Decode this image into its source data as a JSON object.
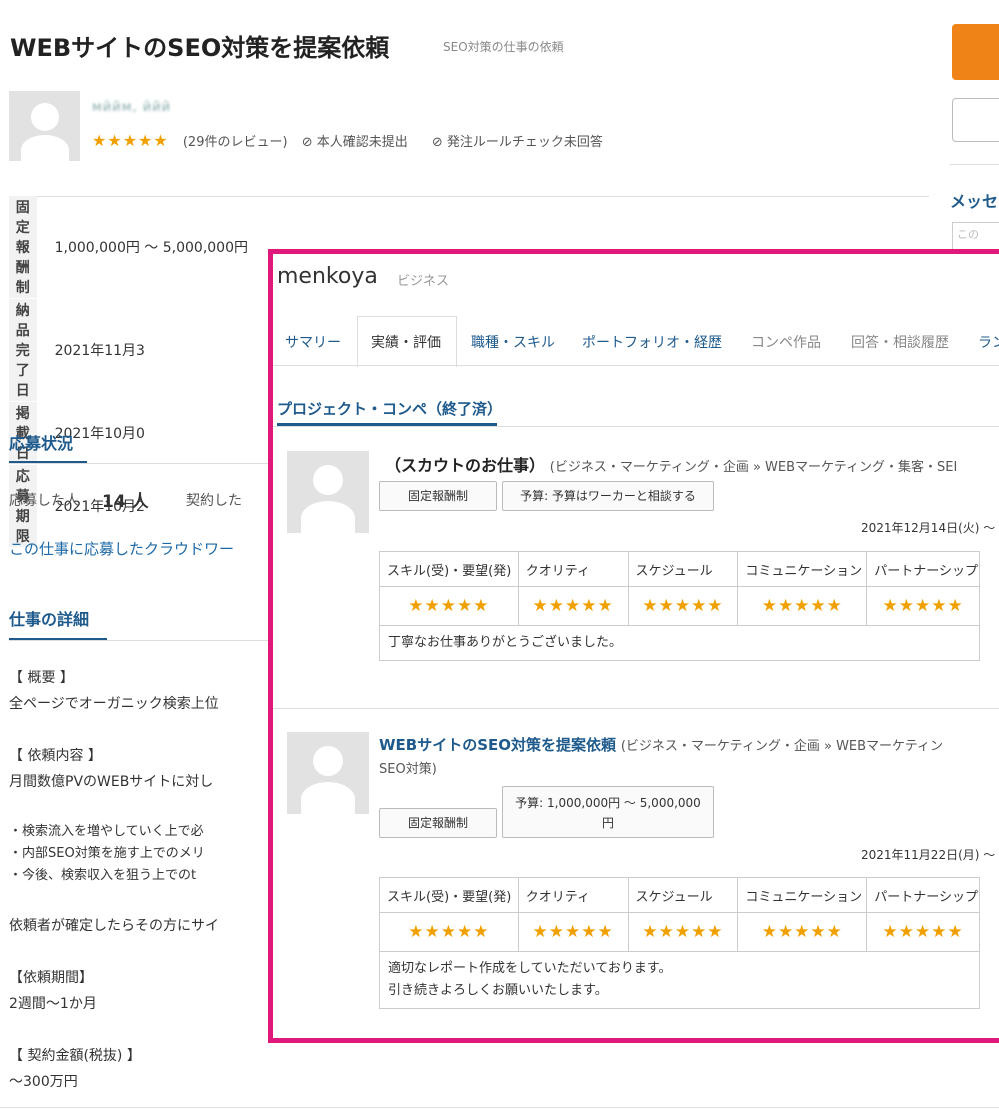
{
  "header": {
    "title": "WEBサイトのSEO対策を提案依頼",
    "subtitle": "SEO対策の仕事の依頼"
  },
  "client": {
    "name": "мӣӣм, ӣӣӣ",
    "stars": "★★★★★",
    "reviews": "(29件のレビュー)",
    "identity": "本人確認未提出",
    "rules": "発注ルールチェック未回答"
  },
  "sidebar_right": {
    "message_heading": "メッセ",
    "message_placeholder": "この"
  },
  "info": [
    {
      "label": "固定報酬制",
      "value": "1,000,000円 〜 5,000,000円"
    },
    {
      "label": "納品完了日",
      "value": "2021年11月3"
    },
    {
      "label": "掲載日",
      "value": "2021年10月0"
    },
    {
      "label": "応募期限",
      "value": "2021年10月2"
    }
  ],
  "status": {
    "title": "応募状況",
    "applied_label": "応募した人",
    "applied_count": "14 人",
    "contracted_label": "契約した",
    "link": "この仕事に応募したクラウドワー"
  },
  "details": {
    "title": "仕事の詳細",
    "lines": [
      "【 概要 】",
      "全ページでオーガニック検索上位",
      "",
      "【 依頼内容 】",
      "月間数億PVのWEBサイトに対し",
      "",
      "・検索流入を増やしていく上で必",
      "・内部SEO対策を施す上でのメリ",
      "・今後、検索収入を狙う上でのt",
      "",
      "依頼者が確定したらその方にサイ",
      "",
      "【依頼期間】",
      "2週間〜1か月",
      "",
      "【 契約金額(税抜) 】",
      "〜300万円"
    ]
  },
  "overlay": {
    "brand": "menkoya",
    "brand_sub": "ビジネス",
    "tabs": [
      "サマリー",
      "実績・評価",
      "職種・スキル",
      "ポートフォリオ・経歴",
      "コンペ作品",
      "回答・相談履歴",
      "ラン"
    ],
    "section_title": "プロジェクト・コンペ（終了済）",
    "rating_headers": [
      "スキル(受)・要望(発)",
      "クオリティ",
      "スケジュール",
      "コミュニケーション",
      "パートナーシップ"
    ],
    "jobs": [
      {
        "title": "（スカウトのお仕事）",
        "category": "(ビジネス・マーケティング・企画 » WEBマーケティング・集客・SEI",
        "category2": "",
        "chip_type": "固定報酬制",
        "chip_budget": "予算: 予算はワーカーと相談する",
        "date": "2021年12月14日(火) 〜",
        "stars": [
          "★★★★★",
          "★★★★★",
          "★★★★★",
          "★★★★★",
          "★★★★★"
        ],
        "comment": "丁寧なお仕事ありがとうございました。",
        "comment2": ""
      },
      {
        "title": "WEBサイトのSEO対策を提案依頼",
        "category": "(ビジネス・マーケティング・企画 » WEBマーケティン",
        "category2": "SEO対策)",
        "chip_type": "固定報酬制",
        "chip_budget": "予算: 1,000,000円 〜 5,000,000",
        "chip_budget2": "円",
        "date": "2021年11月22日(月) 〜",
        "stars": [
          "★★★★★",
          "★★★★★",
          "★★★★★",
          "★★★★★",
          "★★★★★"
        ],
        "comment": "適切なレポート作成をしていただいております。",
        "comment2": "引き続きよろしくお願いいたします。"
      }
    ]
  }
}
